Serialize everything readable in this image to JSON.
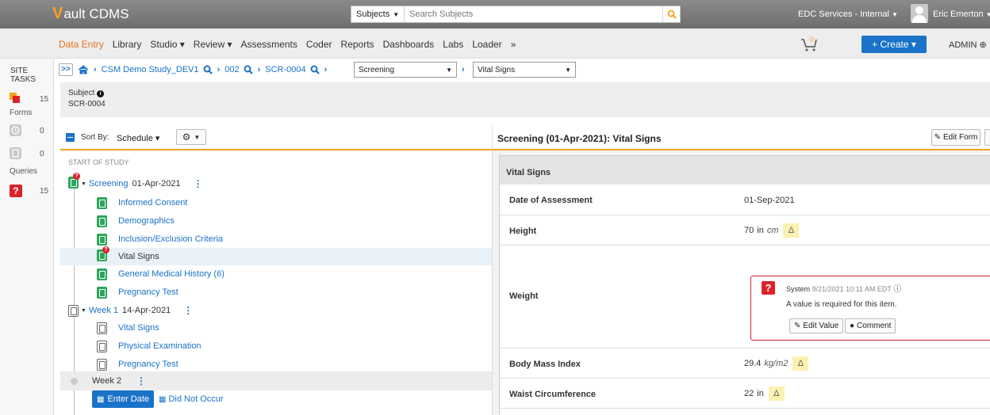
{
  "header": {
    "app_name": "Vault CDMS",
    "search_scope": "Subjects",
    "search_placeholder": "Search Subjects",
    "vault_name": "EDC Services - Internal",
    "user_name": "Eric Emerton"
  },
  "nav": {
    "items": [
      "Data Entry",
      "Library",
      "Studio ▾",
      "Review ▾",
      "Assessments",
      "Coder",
      "Reports",
      "Dashboards",
      "Labs",
      "Loader",
      "»"
    ],
    "active": "Data Entry",
    "create_label": "+ Create ▾",
    "admin_label": "ADMIN",
    "cart_count": "0"
  },
  "rail": {
    "title_line1": "SITE",
    "title_line2": "TASKS",
    "forms_count": "15",
    "forms_label": "Forms",
    "clock_count": "0",
    "doc_count": "0",
    "queries_label": "Queries",
    "queries_count": "15"
  },
  "breadcrumb": {
    "study": "CSM Demo Study_DEV1",
    "site": "002",
    "subject": "SCR-0004",
    "event_select": "Screening",
    "form_select": "Vital Signs"
  },
  "subject": {
    "label": "Subject",
    "value": "SCR-0004"
  },
  "left_panel": {
    "sort_label": "Sort By:",
    "sort_value": "Schedule ▾",
    "start_label": "START OF STUDY",
    "screening": {
      "name": "Screening",
      "date": "01-Apr-2021"
    },
    "screening_forms": [
      "Informed Consent",
      "Demographics",
      "Inclusion/Exclusion Criteria",
      "Vital Signs",
      "General Medical History (6)",
      "Pregnancy Test"
    ],
    "week1": {
      "name": "Week 1",
      "date": "14-Apr-2021"
    },
    "week1_forms": [
      "Vital Signs",
      "Physical Examination",
      "Pregnancy Test"
    ],
    "week2": {
      "name": "Week 2"
    },
    "enter_date_label": "Enter Date",
    "did_not_occur_label": "Did Not Occur"
  },
  "right_panel": {
    "title": "Screening (01-Apr-2021): Vital Signs",
    "edit_form_label": "Edit Form",
    "section": "Vital Signs",
    "fields": [
      {
        "label": "Date of Assessment",
        "value": "01-Sep-2021",
        "unit": ""
      },
      {
        "label": "Height",
        "value": "70",
        "unit1": "in",
        "unit2": "cm"
      },
      {
        "label": "Weight",
        "value": "",
        "unit": ""
      },
      {
        "label": "Body Mass Index",
        "value": "29.4",
        "unit": "kg/m2"
      },
      {
        "label": "Waist Circumference",
        "value": "22",
        "unit": "in"
      }
    ],
    "query": {
      "author": "System",
      "timestamp": "9/21/2021 10:11 AM EDT",
      "message": "A value is required for this item.",
      "edit_value_label": "Edit Value",
      "comment_label": "Comment"
    }
  }
}
